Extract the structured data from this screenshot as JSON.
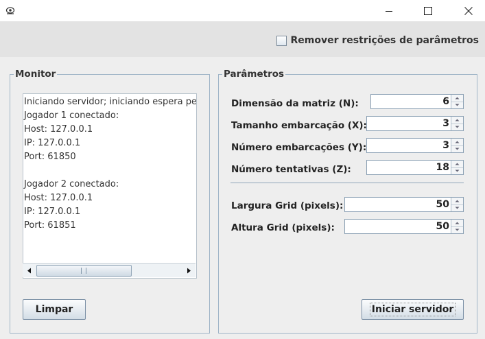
{
  "window": {
    "icon": "app-icon",
    "controls": [
      "minimize-icon",
      "maximize-icon",
      "close-icon"
    ]
  },
  "options": {
    "remove_restrictions_label": "Remover restrições de parâmetros",
    "remove_restrictions_checked": false
  },
  "monitor": {
    "title": "Monitor",
    "log_lines": [
      "Iniciando servidor; iniciando espera pel",
      "Jogador 1 conectado:",
      "Host: 127.0.0.1",
      "IP: 127.0.0.1",
      "Port: 61850",
      "",
      "Jogador 2 conectado:",
      "Host: 127.0.0.1",
      "IP: 127.0.0.1",
      "Port: 61851"
    ],
    "clear_button": "Limpar"
  },
  "params": {
    "title": "Parâmetros",
    "fields": [
      {
        "label": "Dimensão da matriz (N):",
        "value": "6"
      },
      {
        "label": "Tamanho embarcação (X):",
        "value": "3"
      },
      {
        "label": "Número embarcações (Y):",
        "value": "3"
      },
      {
        "label": "Número tentativas (Z):",
        "value": "18"
      }
    ],
    "grid_fields": [
      {
        "label": "Largura Grid (pixels):",
        "value": "50"
      },
      {
        "label": "Altura Grid (pixels):",
        "value": "50"
      }
    ],
    "start_button": "Iniciar servidor"
  }
}
